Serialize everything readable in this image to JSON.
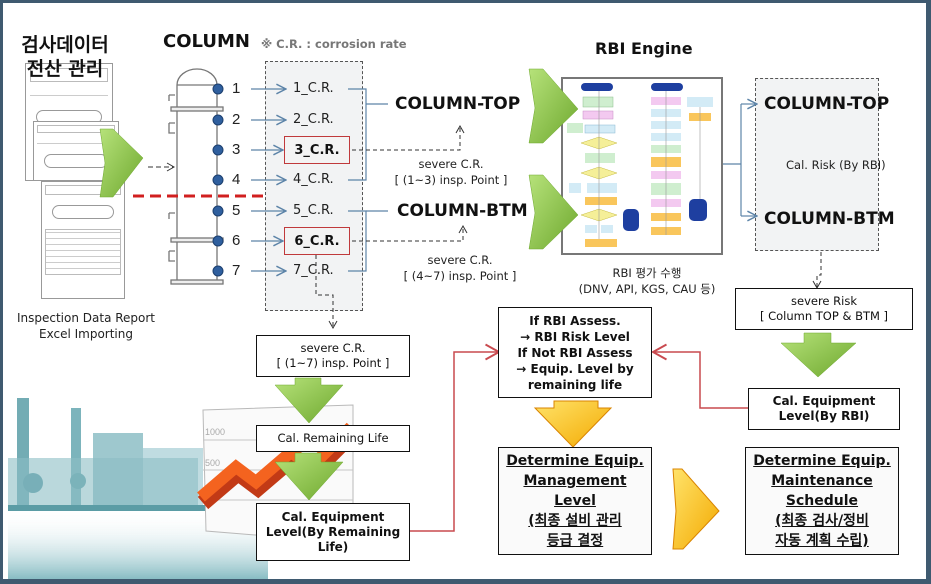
{
  "left_panel": {
    "title_line1": "검사데이터",
    "title_line2": "전산 관리",
    "caption_line1": "Inspection Data Report",
    "caption_line2": "Excel Importing"
  },
  "column": {
    "title": "COLUMN",
    "note": "※ C.R. : corrosion  rate",
    "points": [
      "1",
      "2",
      "3",
      "4",
      "5",
      "6",
      "7"
    ],
    "cr_labels": [
      "1_C.R.",
      "2_C.R.",
      "3_C.R.",
      "4_C.R.",
      "5_C.R.",
      "6_C.R.",
      "7_C.R."
    ],
    "highlighted": [
      "3_C.R.",
      "6_C.R."
    ]
  },
  "groups": {
    "top_label": "COLUMN-TOP",
    "btm_label": "COLUMN-BTM",
    "top_severe_line1": "severe C.R.",
    "top_severe_line2": "[ (1~3) insp. Point ]",
    "btm_severe_line1": "severe C.R.",
    "btm_severe_line2": "[ (4~7) insp. Point ]"
  },
  "rbi": {
    "title": "RBI Engine",
    "caption_line1": "RBI 평가 수행",
    "caption_line2": "(DNV, API, KGS, CAU 등)"
  },
  "risk_panel": {
    "top_label": "COLUMN-TOP",
    "middle_label": "Cal. Risk (By RBI)",
    "btm_label": "COLUMN-BTM"
  },
  "boxes": {
    "severe_all_line1": "severe C.R.",
    "severe_all_line2": "[ (1~7) insp. Point ]",
    "remaining_life": "Cal. Remaining  Life",
    "equip_level_rl_line1": "Cal. Equipment",
    "equip_level_rl_line2": "Level(By Remaining",
    "equip_level_rl_line3": "Life)",
    "decision_line1": "If RBI Assess.",
    "decision_line2": "→ RBI Risk Level",
    "decision_line3": "If Not RBI Assess",
    "decision_line4": "→ Equip. Level by",
    "decision_line5": "remaining life",
    "severe_risk_line1": "severe Risk",
    "severe_risk_line2": "[ Column TOP & BTM ]",
    "equip_level_rbi_line1": "Cal. Equipment",
    "equip_level_rbi_line2": "Level(By RBI)",
    "mgmt_line1": "Determine Equip.",
    "mgmt_line2": "Management",
    "mgmt_line3": "Level",
    "mgmt_line4": "(최종 설비 관리",
    "mgmt_line5": "등급 결정",
    "maint_line1": "Determine Equip.",
    "maint_line2": "Maintenance",
    "maint_line3": "Schedule",
    "maint_line4": "(최종 검사/정비",
    "maint_line5": "자동 계획 수립)"
  },
  "background_chart": {
    "tick_labels": [
      "1000",
      "500"
    ]
  },
  "colors": {
    "frame": "#3f5a70",
    "arrow_green": "#8cc63f",
    "arrow_yellow": "#f7c600",
    "highlight_red": "#c0393b",
    "flow_red": "#c94a4f",
    "connector_blue": "#5d84a8",
    "point_blue": "#2f5f9e"
  }
}
